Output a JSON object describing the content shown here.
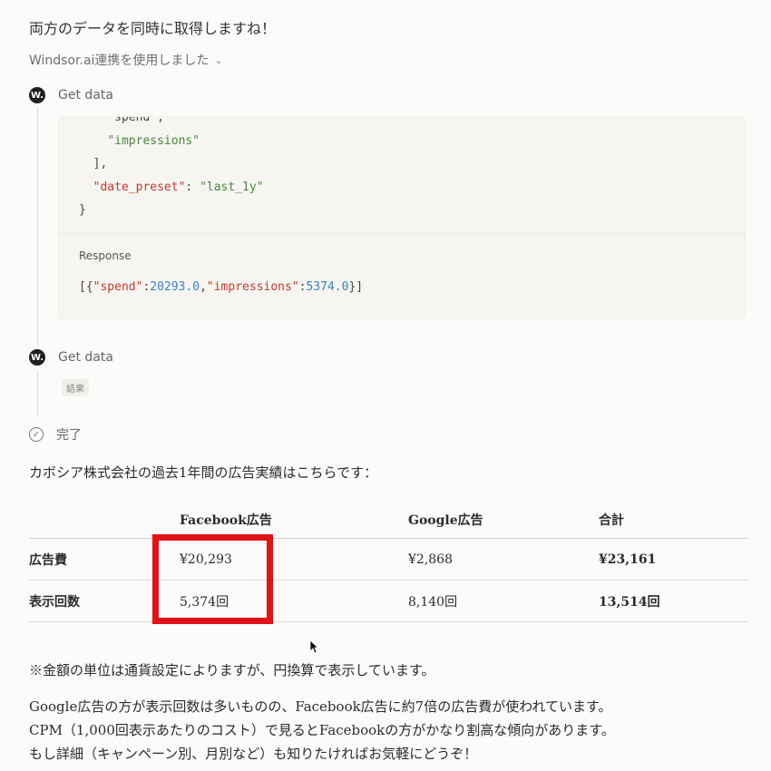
{
  "intro_text": "両方のデータを同時に取得しますね！",
  "integration": {
    "label": "Windsor.ai連携を使用しました",
    "chevron_icon": "chevron-down-icon"
  },
  "steps": [
    {
      "icon": "windsor-logo-icon",
      "icon_text": "W.",
      "label": "Get data"
    },
    {
      "icon": "windsor-logo-icon",
      "icon_text": "W.",
      "label": "Get data",
      "badge": "結果"
    },
    {
      "icon": "check-circle-icon",
      "icon_text": "✓",
      "label": "完了"
    }
  ],
  "request_code": {
    "line1": "    \"spend\",",
    "line2_str": "\"impressions\"",
    "line3": "  ],",
    "key": "\"date_preset\"",
    "colon": ": ",
    "value": "\"last_1y\"",
    "line5": "}"
  },
  "response": {
    "label": "Response",
    "p1": "[{",
    "k1": "\"spend\"",
    "c1": ":",
    "v1": "20293.0",
    "sep": ",",
    "k2": "\"impressions\"",
    "c2": ":",
    "v2": "5374.0",
    "p2": "}]"
  },
  "summary_intro": "カボシア株式会社の過去1年間の広告実績はこちらです：",
  "table": {
    "headers": [
      "",
      "Facebook広告",
      "Google広告",
      "合計"
    ],
    "rows": [
      {
        "label": "広告費",
        "facebook": "¥20,293",
        "google": "¥2,868",
        "total": "¥23,161"
      },
      {
        "label": "表示回数",
        "facebook": "5,374回",
        "google": "8,140回",
        "total": "13,514回"
      }
    ]
  },
  "highlight_color": "#e0121a",
  "note": "※金額の単位は通貨設定によりますが、円換算で表示しています。",
  "analysis": [
    "Google広告の方が表示回数は多いものの、Facebook広告に約7倍の広告費が使われています。",
    "CPM（1,000回表示あたりのコスト）で見るとFacebookの方がかなり割高な傾向があります。",
    "もし詳細（キャンペーン別、月別など）も知りたければお気軽にどうぞ！"
  ]
}
